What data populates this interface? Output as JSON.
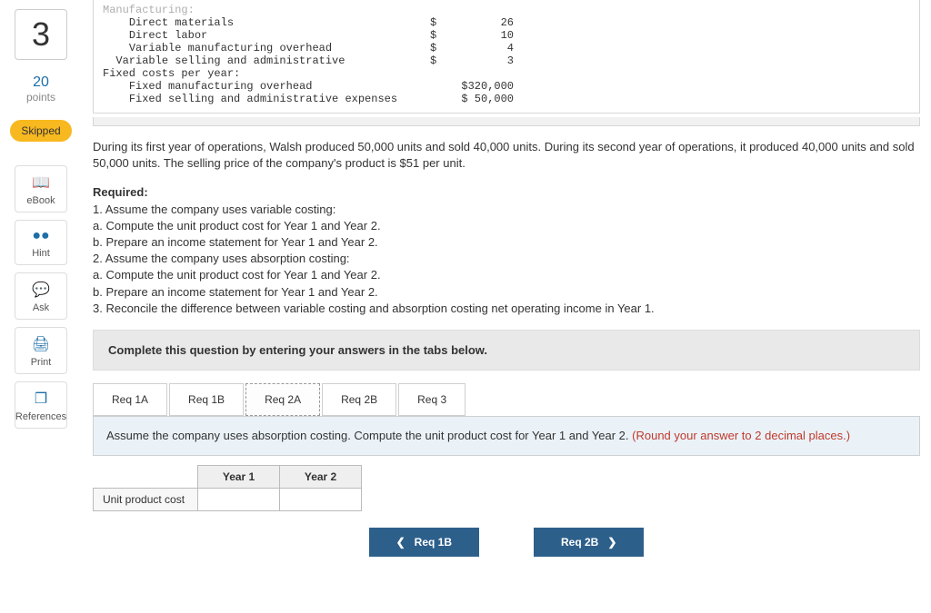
{
  "question": {
    "number": "3",
    "points_value": "20",
    "points_label": "points",
    "status": "Skipped"
  },
  "tools": {
    "ebook": "eBook",
    "hint": "Hint",
    "ask": "Ask",
    "print": "Print",
    "references": "References"
  },
  "cost_data": {
    "header_cut": "Manufacturing:",
    "rows": [
      {
        "indent": "    ",
        "label": "Direct materials",
        "cur": "$",
        "val": "26"
      },
      {
        "indent": "    ",
        "label": "Direct labor",
        "cur": "$",
        "val": "10"
      },
      {
        "indent": "    ",
        "label": "Variable manufacturing overhead",
        "cur": "$",
        "val": "4"
      },
      {
        "indent": "  ",
        "label": "Variable selling and administrative",
        "cur": "$",
        "val": "3"
      },
      {
        "indent": "",
        "label": "Fixed costs per year:",
        "cur": "",
        "val": ""
      },
      {
        "indent": "    ",
        "label": "Fixed manufacturing overhead",
        "cur": "",
        "val": "$320,000"
      },
      {
        "indent": "    ",
        "label": "Fixed selling and administrative expenses",
        "cur": "",
        "val": "$ 50,000"
      }
    ]
  },
  "narrative": "During its first year of operations, Walsh produced 50,000 units and sold 40,000 units. During its second year of operations, it produced 40,000 units and sold 50,000 units. The selling price of the company's product is $51 per unit.",
  "required": {
    "heading": "Required:",
    "lines": [
      "1. Assume the company uses variable costing:",
      "a. Compute the unit product cost for Year 1 and Year 2.",
      "b. Prepare an income statement for Year 1 and Year 2.",
      "2. Assume the company uses absorption costing:",
      "a. Compute the unit product cost for Year 1 and Year 2.",
      "b. Prepare an income statement for Year 1 and Year 2.",
      "3. Reconcile the difference between variable costing and absorption costing net operating income in Year 1."
    ]
  },
  "instruction_bar": "Complete this question by entering your answers in the tabs below.",
  "tabs": [
    {
      "label": "Req 1A"
    },
    {
      "label": "Req 1B"
    },
    {
      "label": "Req 2A"
    },
    {
      "label": "Req 2B"
    },
    {
      "label": "Req 3"
    }
  ],
  "active_tab_prompt": {
    "main": "Assume the company uses absorption costing. Compute the unit product cost for Year 1 and Year 2. ",
    "red": "(Round your answer to 2 decimal places.)"
  },
  "answer_table": {
    "col1": "Year 1",
    "col2": "Year 2",
    "row_label": "Unit product cost"
  },
  "nav": {
    "prev": "Req 1B",
    "next": "Req 2B"
  }
}
